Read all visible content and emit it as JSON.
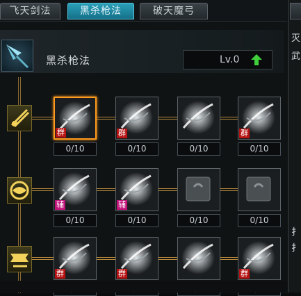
{
  "tabs": [
    {
      "label": "飞天剑法",
      "active": false
    },
    {
      "label": "黑杀枪法",
      "active": true
    },
    {
      "label": "破天魔弓",
      "active": false
    }
  ],
  "header": {
    "title": "黑杀枪法",
    "level": "Lv.0"
  },
  "rows": [
    {
      "skills": [
        {
          "level": "0/10",
          "tag": "群",
          "tag_color": "red",
          "selected": true
        },
        {
          "level": "0/10",
          "tag": "群",
          "tag_color": "red",
          "selected": false
        },
        {
          "level": "0/10",
          "tag": "",
          "tag_color": "",
          "selected": false
        },
        {
          "level": "0/10",
          "tag": "群",
          "tag_color": "red",
          "selected": false
        }
      ]
    },
    {
      "skills": [
        {
          "level": "0/10",
          "tag": "辅",
          "tag_color": "pink",
          "selected": false
        },
        {
          "level": "0/10",
          "tag": "辅",
          "tag_color": "pink",
          "selected": false
        },
        {
          "level": "0/10",
          "tag": "",
          "tag_color": "",
          "selected": false
        },
        {
          "level": "0/10",
          "tag": "",
          "tag_color": "",
          "selected": false
        }
      ]
    },
    {
      "skills": [
        {
          "level": "0/10",
          "tag": "群",
          "tag_color": "red",
          "selected": false
        },
        {
          "level": "0/10",
          "tag": "群",
          "tag_color": "red",
          "selected": false
        },
        {
          "level": "0/10",
          "tag": "",
          "tag_color": "",
          "selected": false
        },
        {
          "level": "0/10",
          "tag": "群",
          "tag_color": "red",
          "selected": false
        }
      ]
    }
  ],
  "side_panel": {
    "title": "灭",
    "line1": "武",
    "line2": "扌",
    "line3": "扌"
  },
  "colors": {
    "accent_tab": "#1f8ea8",
    "selected_border": "#ff9a1e",
    "level_up": "#3fcf3a",
    "connector": "#b98b3b"
  }
}
